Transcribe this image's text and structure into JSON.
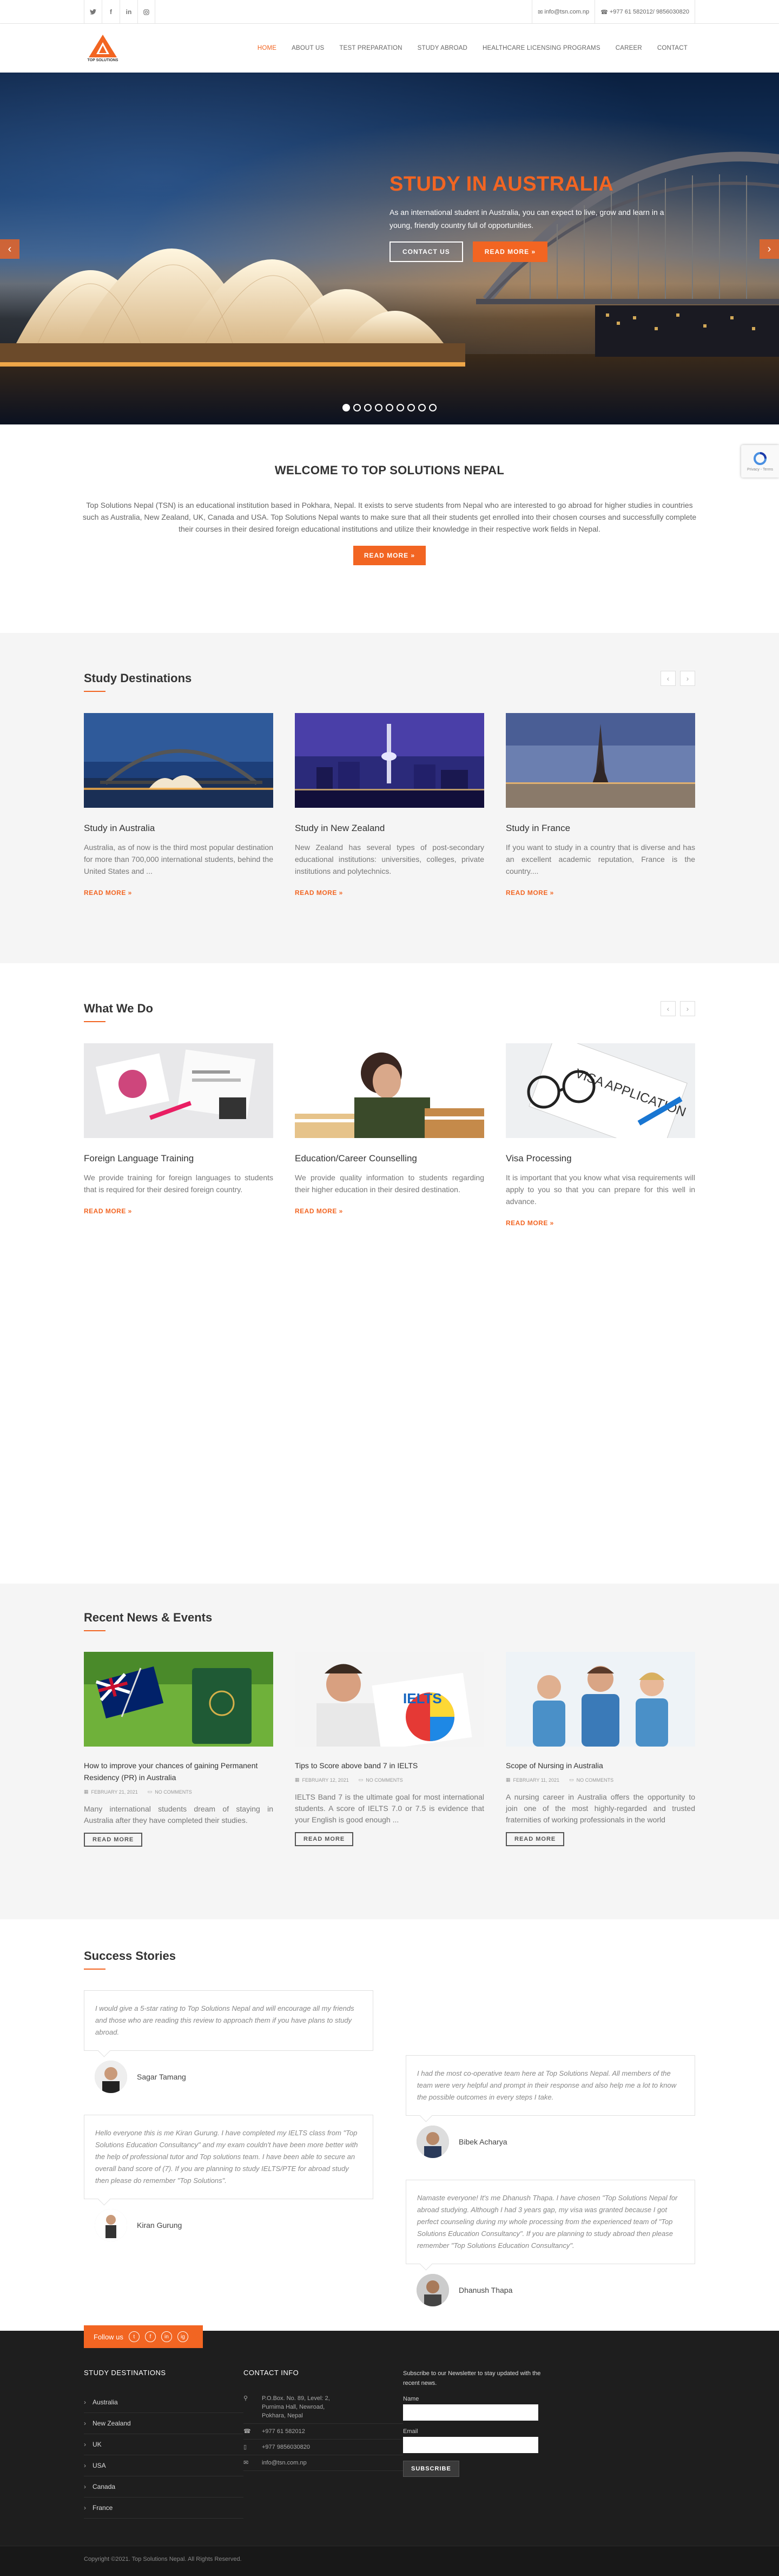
{
  "topbar": {
    "social": [
      "f",
      "t",
      "in",
      "ig"
    ],
    "email": "info@tsn.com.np",
    "phone": "+977 61 582012/ 9856030820"
  },
  "header": {
    "logo_text": "TOP SOLUTIONS",
    "nav": [
      "HOME",
      "ABOUT US",
      "TEST PREPARATION",
      "STUDY ABROAD",
      "HEALTHCARE LICENSING PROGRAMS",
      "CAREER",
      "CONTACT"
    ],
    "active": "HOME"
  },
  "hero": {
    "title": "STUDY IN AUSTRALIA",
    "text": "As an international student in Australia, you can expect to live, grow and learn in a young, friendly country full of opportunities.",
    "btn_contact": "CONTACT US",
    "btn_more": "READ MORE »",
    "slide_count": 9,
    "active_slide": 1
  },
  "recaptcha": {
    "label": "Privacy - Terms"
  },
  "welcome": {
    "title": "WELCOME TO TOP SOLUTIONS NEPAL",
    "text": "Top Solutions Nepal (TSN) is an educational institution based in Pokhara, Nepal. It exists to serve students from Nepal who are interested to go abroad for higher studies in countries such as Australia, New Zealand, UK, Canada and USA. Top Solutions Nepal wants to make sure that all their students get enrolled into their chosen courses and successfully complete their courses in their desired foreign educational institutions and utilize their knowledge in their respective work fields in Nepal.",
    "button": "READ MORE »"
  },
  "destinations": {
    "title": "Study Destinations",
    "items": [
      {
        "title": "Study in Australia",
        "text": "Australia, as of now is the third most popular destination for more than 700,000 international students, behind the United States and ...",
        "more": "READ MORE »"
      },
      {
        "title": "Study in New Zealand",
        "text": "New Zealand has several types of post-secondary educational institutions: universities, colleges, private institutions and polytechnics.",
        "more": "READ MORE »"
      },
      {
        "title": "Study in France",
        "text": "If you want to study in a country that is diverse and has an excellent academic reputation, France is the country....",
        "more": "READ MORE »"
      }
    ]
  },
  "services": {
    "title": "What We Do",
    "items": [
      {
        "title": "Foreign Language Training",
        "text": "We provide training for foreign languages to students that is required for their desired foreign country.",
        "more": "READ MORE »"
      },
      {
        "title": "Education/Career Counselling",
        "text": "We provide quality information to students regarding their higher education in their desired destination.",
        "more": "READ MORE »"
      },
      {
        "title": "Visa Processing",
        "text": "It is important that you know what visa requirements will apply to you so that you can prepare for this well in advance.",
        "more": "READ MORE »",
        "img_text": "VISA APPLICATION"
      }
    ]
  },
  "news": {
    "title": "Recent News & Events",
    "items": [
      {
        "title": "How to improve your chances of gaining Permanent Residency (PR) in Australia",
        "date": "FEBRUARY 21, 2021",
        "comments": "NO COMMENTS",
        "text": "Many international students dream of staying in Australia after they have completed their studies.",
        "more": "READ MORE"
      },
      {
        "title": "Tips to Score above band 7 in IELTS",
        "date": "FEBRUARY 12, 2021",
        "comments": "NO COMMENTS",
        "text": "IELTS Band 7 is the ultimate goal for most international students. A score of IELTS 7.0 or 7.5 is evidence that your English is good enough ...",
        "more": "READ MORE",
        "img_text": "IELTS"
      },
      {
        "title": "Scope of Nursing in Australia",
        "date": "FEBRUARY 11, 2021",
        "comments": "NO COMMENTS",
        "text": "A nursing career in Australia offers the opportunity to join one of the most highly-regarded and trusted fraternities of working professionals in the world",
        "more": "READ MORE"
      }
    ]
  },
  "stories": {
    "title": "Success Stories",
    "items": [
      {
        "text": "I would give a 5-star rating to Top Solutions Nepal and will encourage all my friends and those who are reading this review to approach them if you have plans to study abroad.",
        "name": "Sagar Tamang"
      },
      {
        "text": "I had the most co-operative team here at Top Solutions Nepal. All members of the team were very helpful and prompt in their response and also help me a lot to know the possible outcomes in every steps I take.",
        "name": "Bibek Acharya"
      },
      {
        "text": "Hello everyone this is me Kiran Gurung. I have completed my IELTS class from \"Top Solutions Education Consultancy\" and my exam couldn't have been more better with the help of professional tutor and Top solutions team. I have been able to secure an overall band score of (7). If you are planning to study IELTS/PTE for abroad study then please do remember \"Top Solutions\".",
        "name": "Kiran Gurung"
      },
      {
        "text": "Namaste everyone! It's me Dhanush Thapa. I have chosen \"Top Solutions Nepal for abroad studying. Although I had 3 years gap, my visa was granted because I got perfect counseling during my whole processing from the experienced team of \"Top Solutions Education Consultancy\". If you are planning to study abroad then please remember \"Top Solutions Education Consultancy\".",
        "name": "Dhanush Thapa"
      }
    ]
  },
  "footer": {
    "follow": "Follow us",
    "follow_icons": [
      "t",
      "f",
      "in",
      "ig"
    ],
    "dest_title": "STUDY DESTINATIONS",
    "destinations": [
      "Australia",
      "New Zealand",
      "UK",
      "USA",
      "Canada",
      "France"
    ],
    "contact_title": "CONTACT INFO",
    "address": "P.O.Box. No. 89, Level: 2, Purnima Hall, Newroad, Pokhara, Nepal",
    "phone1": "+977 61 582012",
    "phone2": "+977 9856030820",
    "email": "info@tsn.com.np",
    "newsletter_text": "Subscribe to our Newsletter to stay updated with the recent news.",
    "name_label": "Name",
    "email_label": "Email",
    "subscribe": "SUBSCRIBE",
    "copyright": "Copyright ©2021. Top Solutions Nepal. All Rights Reserved."
  },
  "colors": {
    "accent": "#f26522",
    "footer": "#1e1e1e",
    "gray_bg": "#f5f5f5"
  }
}
